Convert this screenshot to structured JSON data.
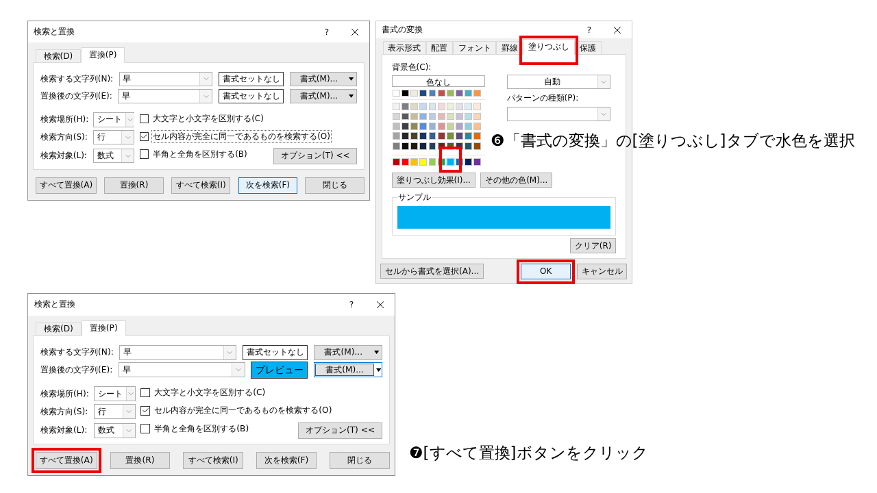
{
  "find_replace_dialog": {
    "title": "検索と置換",
    "help": "?",
    "tabs": [
      {
        "label": "検索(D)",
        "selected": false
      },
      {
        "label": "置換(P)",
        "selected": true
      }
    ],
    "text_rows": [
      {
        "label": "検索する文字列(N):",
        "value": "早",
        "preview": {
          "text": "書式セットなし"
        },
        "format_button": {
          "label": "書式(M)...",
          "focused": false
        }
      },
      {
        "label": "置換後の文字列(E):",
        "value": "早",
        "preview": {
          "text": "書式セットなし"
        },
        "format_button": {
          "label": "書式(M)...",
          "focused": false
        }
      }
    ],
    "scopes": [
      {
        "label": "検索場所(H):",
        "value": "シート"
      },
      {
        "label": "検索方向(S):",
        "value": "行"
      },
      {
        "label": "検索対象(L):",
        "value": "数式"
      }
    ],
    "checkboxes": [
      {
        "label": "大文字と小文字を区別する(C)",
        "checked": false,
        "focused": false
      },
      {
        "label": "セル内容が完全に同一であるものを検索する(O)",
        "checked": true,
        "focused": true
      },
      {
        "label": "半角と全角を区別する(B)",
        "checked": false,
        "focused": false
      }
    ],
    "options_button": "オプション(T) <<",
    "buttons": [
      {
        "label": "すべて置換(A)",
        "default": false,
        "highlighted": false
      },
      {
        "label": "置換(R)",
        "default": false,
        "highlighted": false
      },
      {
        "label": "すべて検索(I)",
        "default": false,
        "highlighted": false
      },
      {
        "label": "次を検索(F)",
        "default": true,
        "highlighted": false
      },
      {
        "label": "閉じる",
        "default": false,
        "highlighted": false
      }
    ]
  },
  "format_cells_dialog": {
    "title": "書式の変換",
    "help": "?",
    "tabs": [
      {
        "label": "表示形式",
        "selected": false,
        "highlighted": false
      },
      {
        "label": "配置",
        "selected": false,
        "highlighted": false
      },
      {
        "label": "フォント",
        "selected": false,
        "highlighted": false
      },
      {
        "label": "罫線",
        "selected": false,
        "highlighted": false
      },
      {
        "label": "塗りつぶし",
        "selected": true,
        "highlighted": true
      },
      {
        "label": "保護",
        "selected": false,
        "highlighted": false
      }
    ],
    "background_label": "背景色(C):",
    "no_color_button": "色なし",
    "theme_colors": [
      {
        "color": "#ffffff"
      },
      {
        "color": "#000000"
      },
      {
        "color": "#eeece1"
      },
      {
        "color": "#1f497d"
      },
      {
        "color": "#4f81bd"
      },
      {
        "color": "#c0504d"
      },
      {
        "color": "#9bbb59"
      },
      {
        "color": "#8064a2"
      },
      {
        "color": "#4bacc6"
      },
      {
        "color": "#f79646"
      }
    ],
    "shades": [
      [
        {
          "color": "#f2f2f2"
        },
        {
          "color": "#7f7f7f"
        },
        {
          "color": "#ddd9c3"
        },
        {
          "color": "#c6d9f0"
        },
        {
          "color": "#dbe5f1"
        },
        {
          "color": "#f2dcdb"
        },
        {
          "color": "#ebf1dd"
        },
        {
          "color": "#e5e0ec"
        },
        {
          "color": "#dbeef3"
        },
        {
          "color": "#fdeada"
        }
      ],
      [
        {
          "color": "#d8d8d8"
        },
        {
          "color": "#595959"
        },
        {
          "color": "#c4bd97"
        },
        {
          "color": "#8db3e2"
        },
        {
          "color": "#b8cce4"
        },
        {
          "color": "#e5b9b7"
        },
        {
          "color": "#d7e3bc"
        },
        {
          "color": "#ccc1d9"
        },
        {
          "color": "#b7dde8"
        },
        {
          "color": "#fbd5b5"
        }
      ],
      [
        {
          "color": "#bfbfbf"
        },
        {
          "color": "#3f3f3f"
        },
        {
          "color": "#938953"
        },
        {
          "color": "#548dd4"
        },
        {
          "color": "#95b3d7"
        },
        {
          "color": "#d99694"
        },
        {
          "color": "#c3d69b"
        },
        {
          "color": "#b2a2c7"
        },
        {
          "color": "#92cddc"
        },
        {
          "color": "#fac08f"
        }
      ],
      [
        {
          "color": "#a5a5a5"
        },
        {
          "color": "#262626"
        },
        {
          "color": "#494429"
        },
        {
          "color": "#17365d"
        },
        {
          "color": "#366092"
        },
        {
          "color": "#953734"
        },
        {
          "color": "#76923c"
        },
        {
          "color": "#5f497a"
        },
        {
          "color": "#31859b"
        },
        {
          "color": "#e36c09"
        }
      ],
      [
        {
          "color": "#7f7f7f"
        },
        {
          "color": "#0c0c0c"
        },
        {
          "color": "#1d1b10"
        },
        {
          "color": "#0f243e"
        },
        {
          "color": "#244061"
        },
        {
          "color": "#632423"
        },
        {
          "color": "#4f6128"
        },
        {
          "color": "#3f3151"
        },
        {
          "color": "#205867"
        },
        {
          "color": "#974806"
        }
      ]
    ],
    "standard_colors": [
      {
        "color": "#c00000",
        "selected": false
      },
      {
        "color": "#ff0000",
        "selected": false
      },
      {
        "color": "#ffc000",
        "selected": false
      },
      {
        "color": "#ffff00",
        "selected": false
      },
      {
        "color": "#92d050",
        "selected": false
      },
      {
        "color": "#00b050",
        "selected": false
      },
      {
        "color": "#00b0f0",
        "selected": true
      },
      {
        "color": "#0070c0",
        "selected": false
      },
      {
        "color": "#002060",
        "selected": false
      },
      {
        "color": "#7030a0",
        "selected": false
      }
    ],
    "effects_button": "塗りつぶし効果(I)...",
    "more_colors_button": "その他の色(M)...",
    "pattern_color": {
      "value": "自動"
    },
    "pattern_style": {
      "label": "パターンの種類(P):"
    },
    "sample": {
      "label": "サンプル",
      "color": "#00b0f0"
    },
    "clear_button": "クリア(R)",
    "pick_button": "セルから書式を選択(A)...",
    "buttons": [
      {
        "label": "OK",
        "default": true,
        "highlighted": true
      },
      {
        "label": "キャンセル",
        "default": false,
        "highlighted": false
      }
    ]
  },
  "find_replace_dialog_2": {
    "title": "検索と置換",
    "help": "?",
    "tabs": [
      {
        "label": "検索(D)",
        "selected": false
      },
      {
        "label": "置換(P)",
        "selected": true
      }
    ],
    "text_rows": [
      {
        "label": "検索する文字列(N):",
        "value": "早",
        "preview": {
          "text": "書式セットなし"
        },
        "format_button": {
          "label": "書式(M)...",
          "focused": false
        }
      },
      {
        "label": "置換後の文字列(E):",
        "value": "早",
        "preview": {
          "text": "プレビュー",
          "color": "#00b0f0"
        },
        "format_button": {
          "label": "書式(M)...",
          "focused": true
        }
      }
    ],
    "scopes": [
      {
        "label": "検索場所(H):",
        "value": "シート"
      },
      {
        "label": "検索方向(S):",
        "value": "行"
      },
      {
        "label": "検索対象(L):",
        "value": "数式"
      }
    ],
    "checkboxes": [
      {
        "label": "大文字と小文字を区別する(C)",
        "checked": false,
        "focused": false
      },
      {
        "label": "セル内容が完全に同一であるものを検索する(O)",
        "checked": true,
        "focused": false
      },
      {
        "label": "半角と全角を区別する(B)",
        "checked": false,
        "focused": false
      }
    ],
    "options_button": "オプション(T) <<",
    "buttons": [
      {
        "label": "すべて置換(A)",
        "default": false,
        "highlighted": true
      },
      {
        "label": "置換(R)",
        "default": false,
        "highlighted": false
      },
      {
        "label": "すべて検索(I)",
        "default": false,
        "highlighted": false
      },
      {
        "label": "次を検索(F)",
        "default": false,
        "highlighted": false
      },
      {
        "label": "閉じる",
        "default": false,
        "highlighted": false
      }
    ]
  },
  "captions": [
    {
      "text": "❻「書式の変換」の[塗りつぶし]タブで水色を選択"
    },
    {
      "text": "❼[すべて置換]ボタンをクリック"
    }
  ]
}
